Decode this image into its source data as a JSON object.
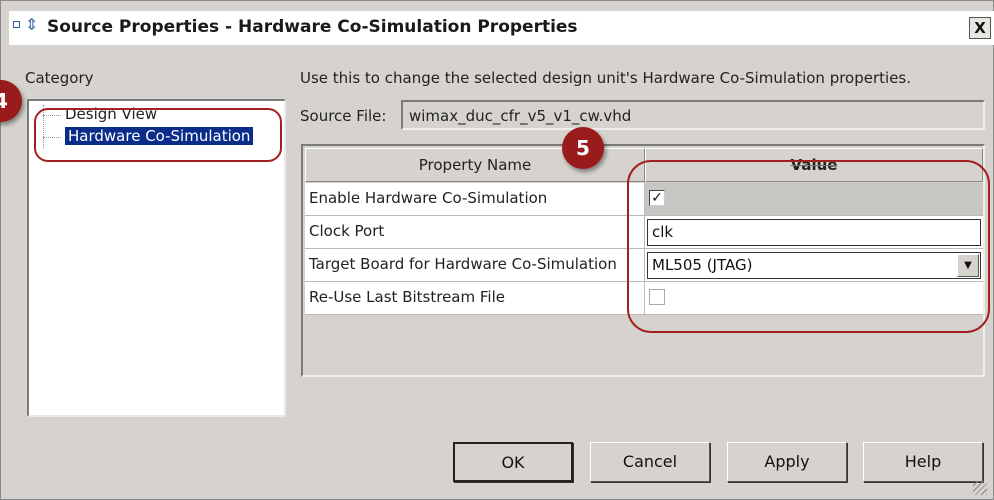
{
  "window": {
    "title": "Source Properties - Hardware Co-Simulation Properties",
    "close_glyph": "X"
  },
  "category": {
    "label": "Category",
    "items": [
      {
        "label": "Design View",
        "selected": false
      },
      {
        "label": "Hardware Co-Simulation",
        "selected": true
      }
    ]
  },
  "main": {
    "description": "Use this to change the selected design unit's Hardware Co-Simulation properties.",
    "source_label": "Source File:",
    "source_value": "wimax_duc_cfr_v5_v1_cw.vhd",
    "grid": {
      "headers": [
        "Property Name",
        "Value"
      ],
      "rows": [
        {
          "name": "Enable Hardware Co-Simulation",
          "type": "checkbox",
          "checked": true,
          "check_glyph": "✓"
        },
        {
          "name": "Clock Port",
          "type": "text",
          "value": "clk"
        },
        {
          "name": "Target Board for Hardware Co-Simulation",
          "type": "select",
          "value": "ML505 (JTAG)",
          "drop_glyph": "▼"
        },
        {
          "name": "Re-Use Last Bitstream File",
          "type": "checkbox",
          "checked": false,
          "check_glyph": ""
        }
      ]
    }
  },
  "buttons": {
    "ok": "OK",
    "cancel": "Cancel",
    "apply": "Apply",
    "help": "Help"
  },
  "annotations": {
    "step4": "4",
    "step5": "5",
    "color": "#9a1b1b"
  }
}
